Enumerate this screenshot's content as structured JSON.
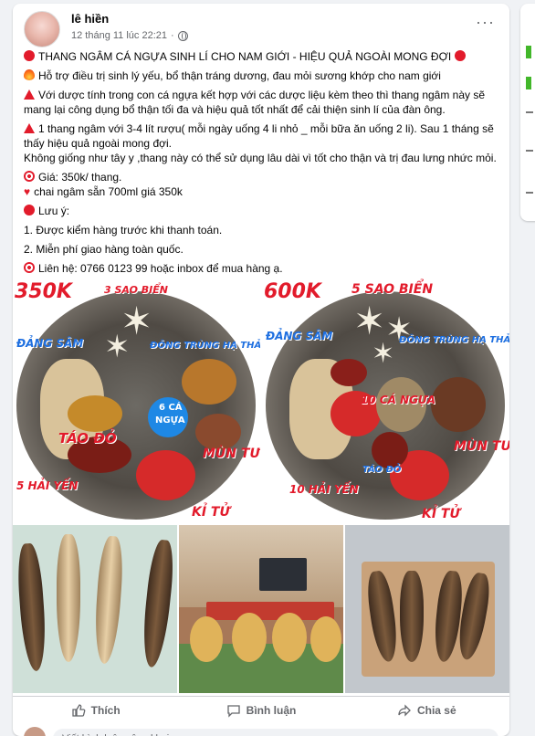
{
  "post": {
    "author": "lê hiền",
    "timestamp": "12 tháng 11 lúc 22:21",
    "more_label": "···",
    "lines": {
      "title": "THANG NGÂM CÁ NGỰA SINH LÍ CHO NAM GIỚI - HIỆU QUẢ NGOÀI MONG ĐỢI",
      "support": "Hỗ trợ điều trị sinh lý yếu, bổ thận tráng dương, đau mỏi sương khớp cho nam giới",
      "combo": "Với dược tính trong con cá ngựa kết hợp với các dược liệu kèm theo thì thang ngâm này sẽ mang lại công dụng bổ thận tối đa và hiệu quả tốt nhất để cải thiện sinh lí của đàn ông.",
      "usage": "1 thang ngâm với 3-4 lít rượu( mỗi ngày uống 4 li nhỏ _ mỗi bữa ăn uống 2 li). Sau 1 tháng sẽ thấy hiệu quả ngoài mong đợi.",
      "usage2": "Không giống như tây y ,thang này có thể sử dụng lâu dài vì tốt cho thận và trị đau lưng nhức mỏi.",
      "price": "Giá: 350k/ thang.",
      "bottle": "chai ngâm sẵn 700ml giá 350k",
      "note_title": "Lưu ý:",
      "note1": "1. Được kiểm hàng trước khi thanh toán.",
      "note2": "2. Miễn phí giao hàng toàn quốc.",
      "contact": "Liên hệ: 0766 0123 99 hoặc inbox để mua hàng ạ."
    }
  },
  "photos": {
    "p1": {
      "price": "350K",
      "labels": {
        "sao_bien": "3 SAO BIỂN",
        "dang_sam": "ĐẢNG SÂM",
        "dong_trung": "ĐÔNG TRÙNG HẠ THẢO",
        "ca_ngua_top": "6 CÁ",
        "ca_ngua_bottom": "NGỰA",
        "tao_do": "TÁO ĐỎ",
        "mun_tun": "MÙN TƯN",
        "hai_yen": "5 HẢI YẾN",
        "ki_tu": "KỈ TỬ"
      }
    },
    "p2": {
      "price": "600K",
      "labels": {
        "sao_bien": "5 SAO BIỂN",
        "dang_sam": "ĐẢNG SÂM",
        "dong_trung": "ĐÔNG TRÙNG HẠ THẢO",
        "ca_ngua": "10 CÁ NGỰA",
        "tao_do": "TÁO ĐỎ",
        "mun_tun": "MÙN TƯN",
        "hai_yen": "10 HẢI YẾN",
        "ki_tu": "KỈ TỬ"
      }
    }
  },
  "actions": {
    "like": "Thích",
    "comment": "Bình luận",
    "share": "Chia sẻ"
  },
  "comment_placeholder": "Viết bình luận công khai..."
}
